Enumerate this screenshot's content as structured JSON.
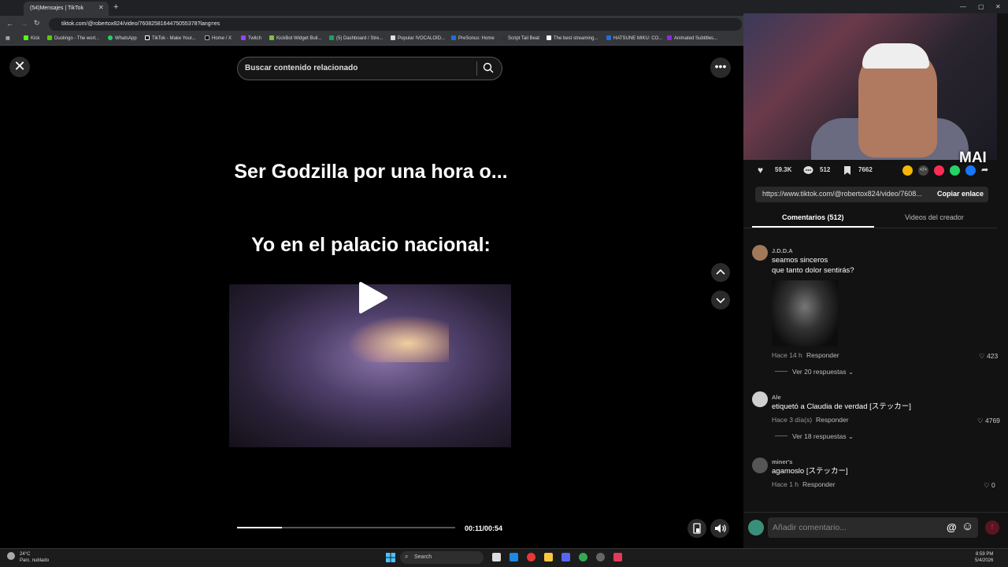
{
  "browser": {
    "tab_title": "(54)Mensajes | TikTok",
    "new_tab": "+",
    "url": "tiktok.com/@robertox824/video/7608258164475055378?lang=es",
    "bookmarks": [
      "Kick",
      "Duolingo - The worl...",
      "WhatsApp",
      "TikTok - Make Your...",
      "Home / X",
      "Twitch",
      "KickBot Widget Buil...",
      "(5) Dashboard / Stre...",
      "Popular !VOCALOID...",
      "PreSonus: Home",
      "Script Tail Beat",
      "The best streaming...",
      "HATSUNE MIKU: CO...",
      "Animated Subtitles..."
    ]
  },
  "video": {
    "close_icon": "✕",
    "search_placeholder": "Buscar contenido relacionado",
    "caption_top": "Ser Godzilla por una hora o...",
    "caption_bottom": "Yo en el palacio nacional:",
    "current_time": "00:11/00:54",
    "progress": 0.204,
    "more_icon": "•••"
  },
  "stream": {
    "overlay_tag": "MAI"
  },
  "panel": {
    "likes": "59.3K",
    "comments_count": "512",
    "saves": "7662",
    "share_colors": [
      "#f5b800",
      "#444444",
      "#fe2c55",
      "#25d366",
      "#1877f2"
    ],
    "link": "https://www.tiktok.com/@robertox824/video/7608...",
    "copy_label": "Copiar enlace",
    "tab_comments": "Comentarios (512)",
    "tab_creator": "Videos del creador",
    "comments": [
      {
        "user": "J.D.D.A",
        "text1": "seamos sinceros",
        "text2": "que tanto dolor sentirás?",
        "time": "Hace 14 h",
        "reply": "Responder",
        "likes": "423",
        "more": "Ver 20 respuestas"
      },
      {
        "user": "Ale",
        "text1": "etiquetó a Claudia de verdad [ステッカー]",
        "time": "Hace 3 día(s)",
        "reply": "Responder",
        "likes": "4769",
        "more": "Ver 18 respuestas"
      },
      {
        "user": "miner's",
        "text1": "agamoslo [ステッカー]",
        "time": "Hace 1 h",
        "reply": "Responder",
        "likes": "0"
      }
    ],
    "input_placeholder": "Añadir comentario...",
    "at_icon": "@",
    "emoji_icon": "☺",
    "send_icon": "↑"
  },
  "taskbar": {
    "weather_temp": "24°C",
    "weather_desc": "Parc. nublado",
    "search": "Search",
    "time": "8:59 PM",
    "date": "5/4/2026"
  }
}
